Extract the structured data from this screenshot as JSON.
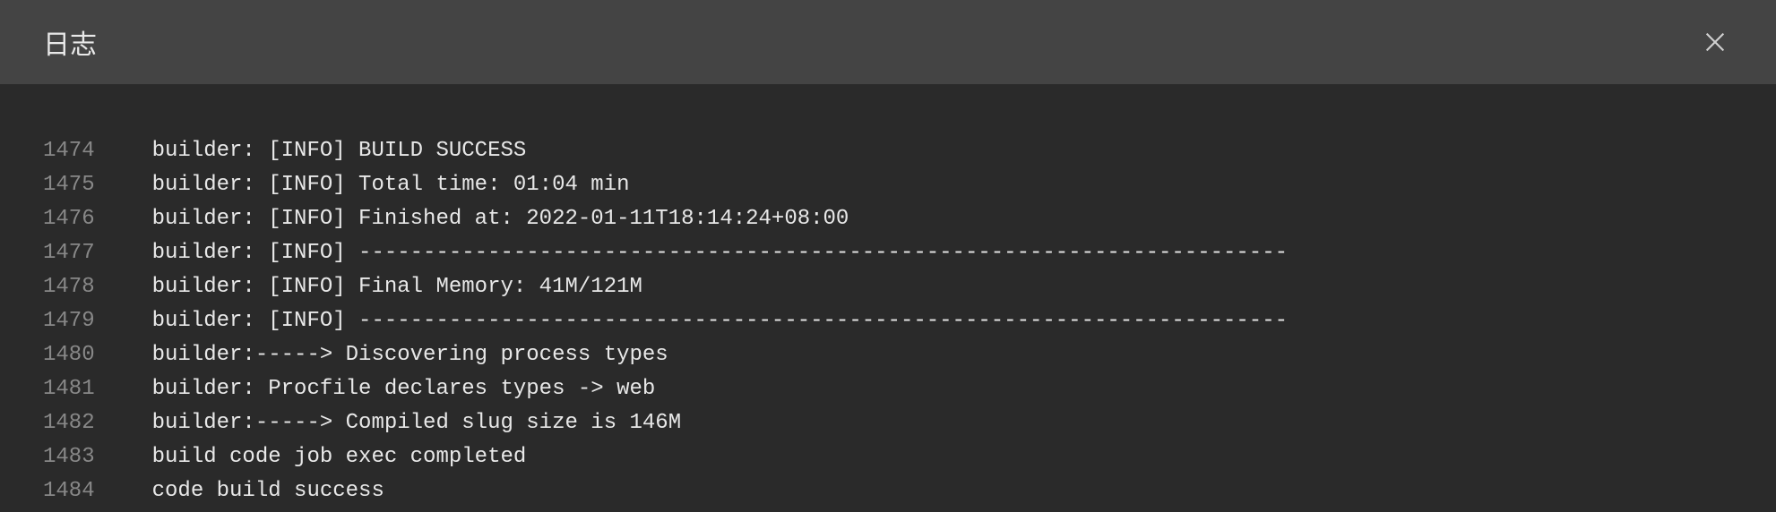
{
  "header": {
    "title": "日志"
  },
  "log": {
    "lines": [
      {
        "number": "1474",
        "text": "builder: [INFO] BUILD SUCCESS"
      },
      {
        "number": "1475",
        "text": "builder: [INFO] Total time: 01:04 min"
      },
      {
        "number": "1476",
        "text": "builder: [INFO] Finished at: 2022-01-11T18:14:24+08:00"
      },
      {
        "number": "1477",
        "text": "builder: [INFO] ------------------------------------------------------------------------"
      },
      {
        "number": "1478",
        "text": "builder: [INFO] Final Memory: 41M/121M"
      },
      {
        "number": "1479",
        "text": "builder: [INFO] ------------------------------------------------------------------------"
      },
      {
        "number": "1480",
        "text": "builder:-----> Discovering process types"
      },
      {
        "number": "1481",
        "text": "builder: Procfile declares types -> web"
      },
      {
        "number": "1482",
        "text": "builder:-----> Compiled slug size is 146M"
      },
      {
        "number": "1483",
        "text": "build code job exec completed"
      },
      {
        "number": "1484",
        "text": "code build success"
      }
    ]
  }
}
